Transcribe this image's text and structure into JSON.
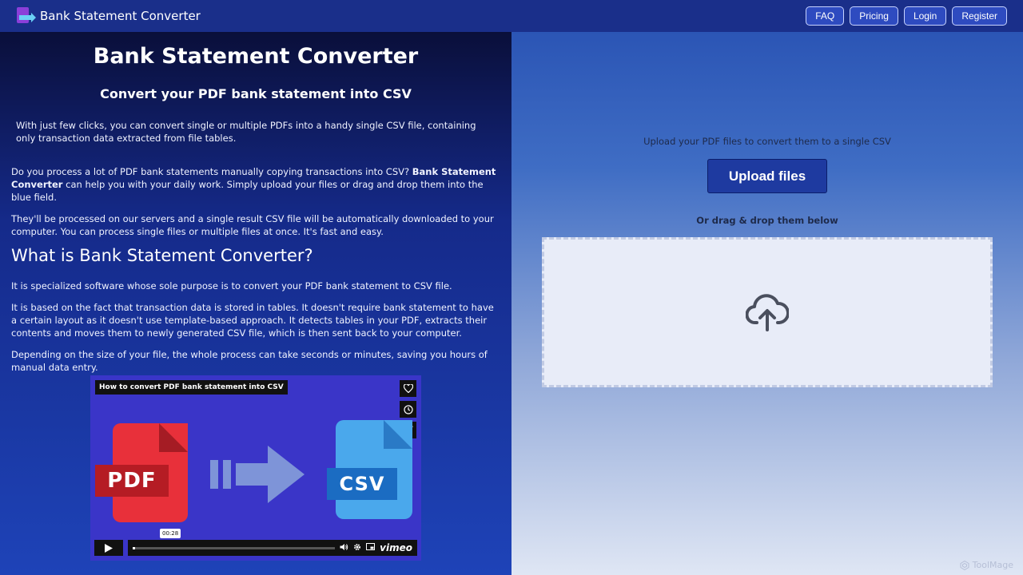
{
  "nav": {
    "brand": "Bank Statement Converter",
    "links": [
      "FAQ",
      "Pricing",
      "Login",
      "Register"
    ]
  },
  "left": {
    "title": "Bank Statement Converter",
    "subtitle": "Convert your PDF bank statement into CSV",
    "intro": "With just few clicks, you can convert single or multiple PDFs into a handy single CSV file, containing only transaction data extracted from file tables.",
    "p1_before": "Do you process a lot of PDF bank statements manually copying transactions into CSV? ",
    "p1_bold": "Bank Statement Converter",
    "p1_after": " can help you with your daily work. Simply upload your files or drag and drop them into the blue field.",
    "p2": "They'll be processed on our servers and a single result CSV file will be automatically downloaded to your computer. You can process single files or multiple files at once. It's fast and easy.",
    "heading": "What is Bank Statement Converter?",
    "p3": "It is specialized software whose sole purpose is to convert your PDF bank statement to CSV file.",
    "p4": "It is based on the fact that transaction data is stored in tables. It doesn't require bank statement to have a certain layout as it doesn't use template-based approach. It detects tables in your PDF, extracts their contents and moves them to newly generated CSV file, which is then sent back to your computer.",
    "p5": "Depending on the size of your file, the whole process can take seconds or minutes, saving you hours of manual data entry."
  },
  "video": {
    "title": "How to convert PDF bank statement into CSV",
    "pdf_label": "PDF",
    "csv_label": "CSV",
    "time": "00:28",
    "brand": "vimeo",
    "progress": 0.01
  },
  "right": {
    "upload_caption": "Upload your PDF files to convert them to a single CSV",
    "upload_button": "Upload files",
    "drag_caption": "Or drag & drop them below"
  },
  "watermark": "ToolMage"
}
